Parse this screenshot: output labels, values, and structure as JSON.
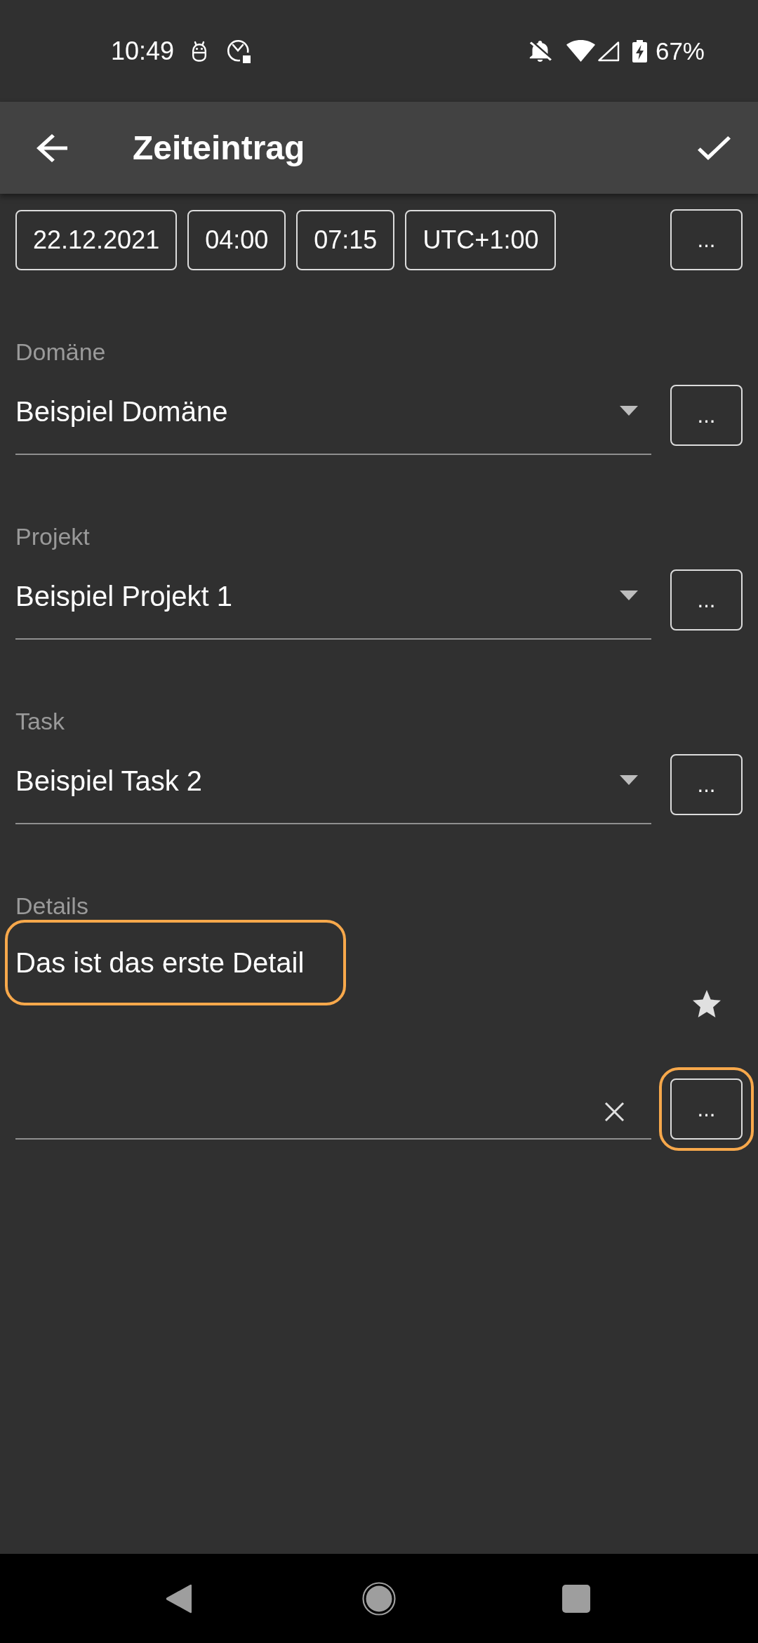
{
  "status_bar": {
    "time": "10:49",
    "battery": "67%"
  },
  "app_bar": {
    "title": "Zeiteintrag"
  },
  "time_row": {
    "chips": [
      "22.12.2021",
      "04:00",
      "07:15",
      "UTC+1:00"
    ],
    "more_button": {
      "label": "...",
      "highlighted": false
    }
  },
  "fields": [
    {
      "label": "Domäne",
      "value": "Beispiel Domäne",
      "more_button": {
        "label": "...",
        "highlighted": false
      }
    },
    {
      "label": "Projekt",
      "value": "Beispiel Projekt 1",
      "more_button": {
        "label": "...",
        "highlighted": false
      }
    },
    {
      "label": "Task",
      "value": "Beispiel Task 2",
      "more_button": {
        "label": "...",
        "highlighted": false
      }
    }
  ],
  "details": {
    "label": "Details",
    "entries": [
      {
        "text": "Das ist das erste Detail",
        "highlighted": true
      }
    ],
    "new_entry": {
      "more_button": {
        "label": "...",
        "highlighted": true
      }
    }
  }
}
